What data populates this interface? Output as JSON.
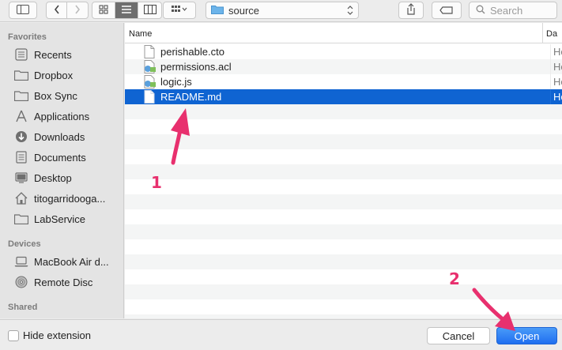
{
  "toolbar": {
    "path_label": "source",
    "search_placeholder": "Search",
    "icons": [
      "sidebar-toggle-icon",
      "back-icon",
      "forward-icon",
      "icon-view-icon",
      "list-view-icon",
      "column-view-icon",
      "group-icon",
      "folder-icon",
      "share-icon",
      "tag-icon",
      "search-icon"
    ]
  },
  "sidebar": {
    "favorites_title": "Favorites",
    "favorites": [
      {
        "label": "Recents",
        "icon": "recents-icon"
      },
      {
        "label": "Dropbox",
        "icon": "folder-icon"
      },
      {
        "label": "Box Sync",
        "icon": "folder-icon"
      },
      {
        "label": "Applications",
        "icon": "applications-icon"
      },
      {
        "label": "Downloads",
        "icon": "downloads-icon"
      },
      {
        "label": "Documents",
        "icon": "documents-icon"
      },
      {
        "label": "Desktop",
        "icon": "desktop-icon"
      },
      {
        "label": "titogarridooga...",
        "icon": "home-icon"
      },
      {
        "label": "LabService",
        "icon": "folder-icon"
      }
    ],
    "devices_title": "Devices",
    "devices": [
      {
        "label": "MacBook Air d...",
        "icon": "laptop-icon"
      },
      {
        "label": "Remote Disc",
        "icon": "disc-icon"
      }
    ],
    "shared_title": "Shared"
  },
  "filelist": {
    "col_name": "Name",
    "col_date": "Da",
    "files": [
      {
        "name": "perishable.cto",
        "date": "Ho",
        "icon": "document-icon",
        "selected": false
      },
      {
        "name": "permissions.acl",
        "date": "Ho",
        "icon": "script-icon",
        "selected": false
      },
      {
        "name": "logic.js",
        "date": "Ho",
        "icon": "script-icon",
        "selected": false
      },
      {
        "name": "README.md",
        "date": "Ho",
        "icon": "document-icon",
        "selected": true
      }
    ]
  },
  "annotations": {
    "step1": "1",
    "step2": "2"
  },
  "bottombar": {
    "hide_extension_label": "Hide extension",
    "cancel_label": "Cancel",
    "open_label": "Open"
  },
  "colors": {
    "selection": "#0f64d2",
    "annotation": "#e8306e",
    "primary_button": "#1f6ef0"
  }
}
